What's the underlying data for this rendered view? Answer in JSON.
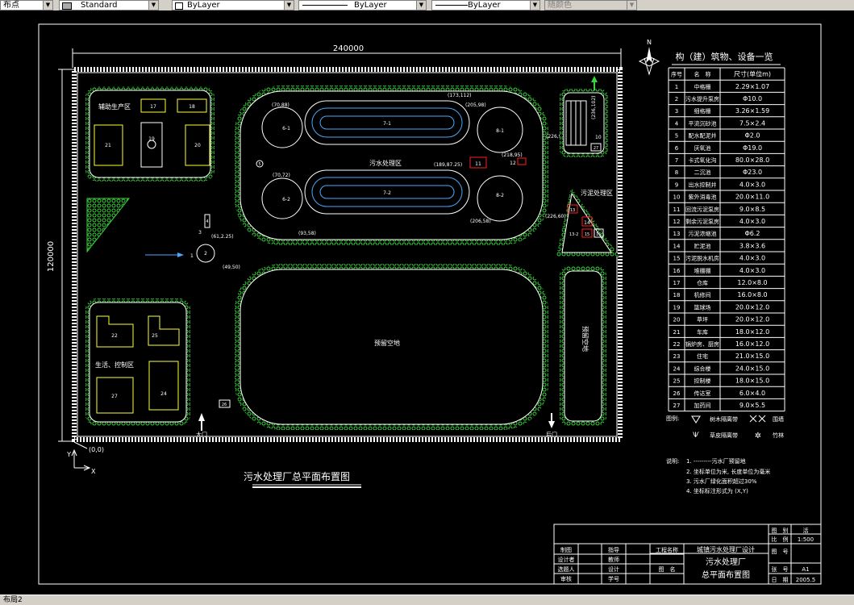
{
  "toolbar": {
    "combo1": "布点",
    "combo2": "Standard",
    "layer": "ByLayer",
    "linetype": "ByLayer",
    "lineweight": "ByLayer",
    "color": "随颜色"
  },
  "status": {
    "layout_tab": "布局2"
  },
  "drawing": {
    "dim_width": "240000",
    "dim_height": "120000",
    "origin": "(0,0)",
    "axis_x": "X",
    "axis_y": "Y",
    "north": "N",
    "main_title": "污水处理厂总平面布置图",
    "zones": {
      "aux": "辅助生产区",
      "treatment": "污水处理区",
      "sludge": "污泥处理区",
      "living": "生活、控制区",
      "reserve_center": "预留空地",
      "reserve_right": "预留空地"
    },
    "gates": {
      "main": "大门",
      "rear": "后门"
    },
    "coords": {
      "c1": "(70,88)",
      "c2": "(70,72)",
      "c3": "(173,112)",
      "c4": "(205,98)",
      "c5": "(226,96)",
      "c6": "(236,102)",
      "c7": "(218,95)",
      "c8": "(189,87.25)",
      "c9": "(93,58)",
      "c10": "(206,58)",
      "c11": "(226,60)",
      "c12": "(61,2.25)",
      "c13": "(49,50)"
    },
    "units": {
      "u6_1": "6-1",
      "u6_2": "6-2",
      "u8_1": "8-1",
      "u8_2": "8-2",
      "u7_1": "7-1",
      "u7_2": "7-2",
      "u5": "5",
      "u11": "11",
      "u12": "12",
      "u13": "13",
      "u14": "14",
      "u15": "15",
      "u16": "16",
      "u13_2": "13-2",
      "u17": "17",
      "u18": "18",
      "u19": "19",
      "u20": "20",
      "u21": "21",
      "u22": "22",
      "u24": "24",
      "u25": "25",
      "u26": "26",
      "u27": "27",
      "u10": "10",
      "u3": "3",
      "u4": "4",
      "u1": "1",
      "u2": "2"
    }
  },
  "legend_table": {
    "title": "构（建）筑物、设备一览",
    "headers": [
      "序号",
      "名　称",
      "尺寸(单位m)"
    ],
    "rows": [
      [
        "1",
        "中格栅",
        "2.29×1.07"
      ],
      [
        "2",
        "污水提升泵房",
        "Φ10.0"
      ],
      [
        "3",
        "细格栅",
        "3.26×1.59"
      ],
      [
        "4",
        "平流沉砂池",
        "7.5×2.4"
      ],
      [
        "5",
        "配水配泥井",
        "Φ2.0"
      ],
      [
        "6",
        "厌氧池",
        "Φ19.0"
      ],
      [
        "7",
        "卡式氧化沟",
        "80.0×28.0"
      ],
      [
        "8",
        "二沉池",
        "Φ23.0"
      ],
      [
        "9",
        "出水控制井",
        "4.0×3.0"
      ],
      [
        "10",
        "紫外消毒池",
        "20.0×11.0"
      ],
      [
        "11",
        "回流污泥泵房",
        "9.0×8.5"
      ],
      [
        "12",
        "剩余污泥泵房",
        "4.0×3.0"
      ],
      [
        "13",
        "污泥浓缩池",
        "Φ6.2"
      ],
      [
        "14",
        "贮泥池",
        "3.8×3.6"
      ],
      [
        "15",
        "污泥脱水机房",
        "4.0×3.0"
      ],
      [
        "16",
        "堆棚棚",
        "4.0×3.0"
      ],
      [
        "17",
        "仓库",
        "12.0×8.0"
      ],
      [
        "18",
        "机修间",
        "16.0×8.0"
      ],
      [
        "19",
        "篮球场",
        "20.0×12.0"
      ],
      [
        "20",
        "草坪",
        "20.0×12.0"
      ],
      [
        "21",
        "车库",
        "18.0×12.0"
      ],
      [
        "22",
        "锅炉房、厨房",
        "16.0×12.0"
      ],
      [
        "23",
        "住宅",
        "21.0×15.0"
      ],
      [
        "24",
        "综合楼",
        "24.0×15.0"
      ],
      [
        "25",
        "控制楼",
        "18.0×15.0"
      ],
      [
        "26",
        "传达室",
        "6.0×4.0"
      ],
      [
        "27",
        "加药间",
        "9.0×5.5"
      ]
    ]
  },
  "legend": {
    "label": "图例:",
    "items": [
      "树木隔离带",
      "围墙",
      "草皮隔离带",
      "竹林"
    ]
  },
  "notes": {
    "label": "说明:",
    "lines": [
      "1. ---------污水厂预留地",
      "2. 坐标单位为米, 长度单位为毫米",
      "3. 污水厂绿化面积超过30%",
      "4. 坐标标注形式为 (X,Y)"
    ]
  },
  "title_block": {
    "drawing_no_label": "图　别",
    "drawing_no_value": "活",
    "scale_label": "比　例",
    "scale_value": "1:500",
    "fig_no_label": "图　号",
    "sheet_label": "张　号",
    "sheet_value": "A1",
    "date_label": "日　期",
    "date_value": "2005.5",
    "l_zhitu": "制图",
    "l_design": "设计者",
    "l_select": "选题人",
    "l_review": "审核",
    "l_guide": "指导",
    "l_teacher": "教师",
    "l_design2": "设计",
    "l_student_no": "学号",
    "project_label": "工程名称",
    "project_value": "城镇污水处理厂设计",
    "name_label": "图　名",
    "name_value_1": "污水处理厂",
    "name_value_2": "总平面布置图"
  },
  "colors": {
    "background": "#000000",
    "line": "#ffffff",
    "green": "#39d33a",
    "yellow": "#ffff33",
    "red": "#ff2020",
    "cyan": "#4aa7ff"
  }
}
